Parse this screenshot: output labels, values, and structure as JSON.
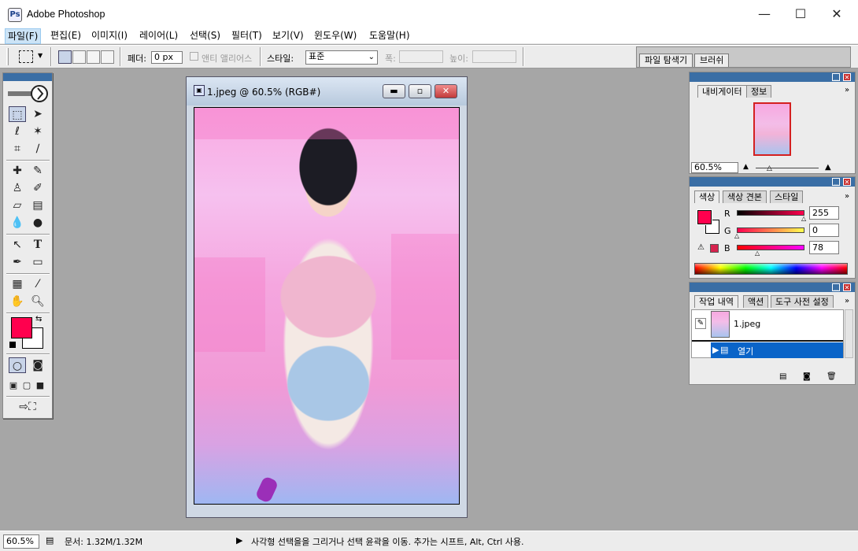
{
  "app": {
    "title": "Adobe Photoshop",
    "icon": "photoshop-app-icon"
  },
  "window_controls": {
    "minimize": "—",
    "maximize": "☐",
    "close": "✕"
  },
  "menu": [
    "파일(F)",
    "편집(E)",
    "이미지(I)",
    "레이어(L)",
    "선택(S)",
    "필터(T)",
    "보기(V)",
    "윈도우(W)",
    "도움말(H)"
  ],
  "options_bar": {
    "feather_label": "페더:",
    "feather_value": "0 px",
    "antialias_label": "앤티 앨리어스",
    "style_label": "스타일:",
    "style_value": "표준",
    "width_label": "폭:",
    "height_label": "높이:"
  },
  "palette_well": {
    "tabs": [
      "파일 탐색기",
      "브러쉬"
    ]
  },
  "document": {
    "title": "1.jpeg @ 60.5% (RGB#)"
  },
  "navigator": {
    "tabs": [
      "내비게이터",
      "정보"
    ],
    "zoom": "60.5%"
  },
  "color": {
    "tabs": [
      "색상",
      "색상 견본",
      "스타일"
    ],
    "channels": [
      {
        "label": "R",
        "value": "255"
      },
      {
        "label": "G",
        "value": "0"
      },
      {
        "label": "B",
        "value": "78"
      }
    ],
    "foreground": "#ff004e"
  },
  "history": {
    "tabs": [
      "작업 내역",
      "액션",
      "도구 사전 설정"
    ],
    "snapshot": "1.jpeg",
    "step": "열기"
  },
  "status": {
    "zoom": "60.5%",
    "doc_info": "문서: 1.32M/1.32M",
    "hint": "사각형 선택을을 그리거나 선택 윤곽을 이동. 추가는 시프트, Alt, Ctrl 사용."
  },
  "colors": {
    "accent": "#3a6ea5",
    "selection_blue": "#0a64c8",
    "foreground": "#ff004e"
  }
}
